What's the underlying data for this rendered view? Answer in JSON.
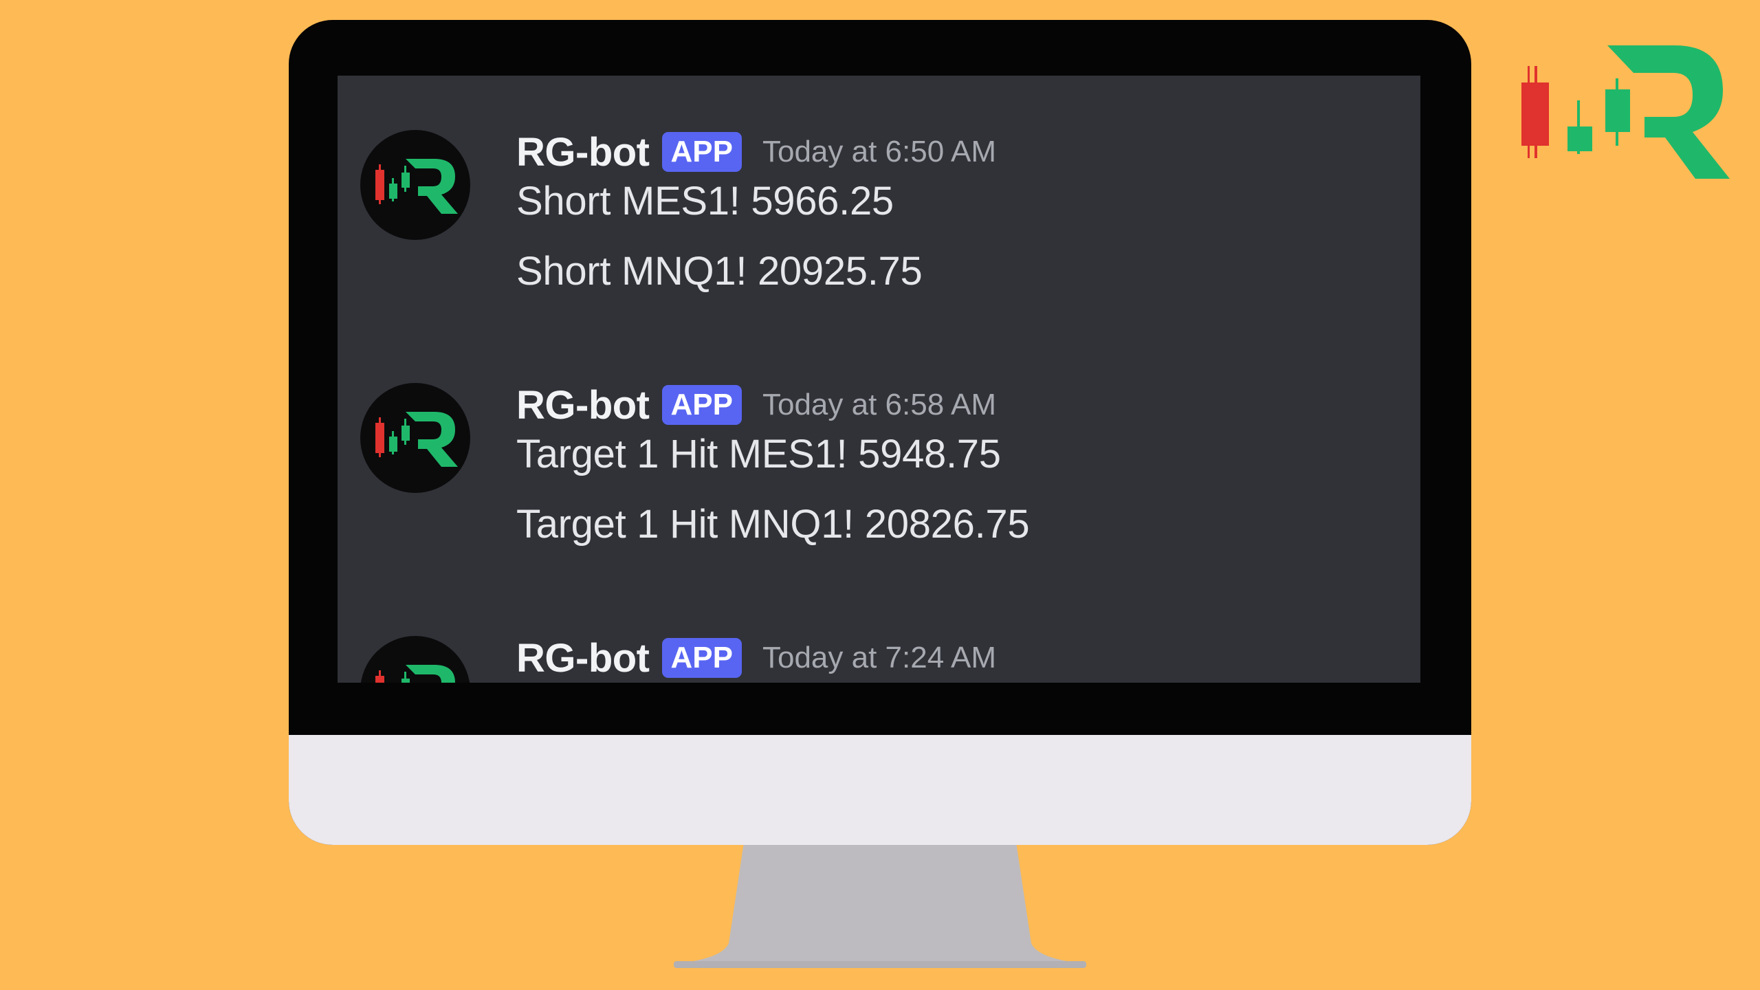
{
  "page": {
    "background_color": "#FEBA54",
    "monitor_bezel_color": "#050505",
    "monitor_chin_color": "#EBE8EE",
    "stand_color": "#BDBBBF",
    "screen_background": "#313238"
  },
  "brand": {
    "logo_icon": "candlestick-r-logo-icon",
    "red": "#E0322E",
    "green": "#1FB86A"
  },
  "chat": {
    "messages": [
      {
        "author": "RG-bot",
        "badge": "APP",
        "timestamp": "Today at 6:50 AM",
        "avatar_icon": "rg-logo-avatar-icon",
        "lines": [
          "Short MES1! 5966.25",
          "Short MNQ1! 20925.75"
        ]
      },
      {
        "author": "RG-bot",
        "badge": "APP",
        "timestamp": "Today at 6:58 AM",
        "avatar_icon": "rg-logo-avatar-icon",
        "lines": [
          "Target 1 Hit MES1! 5948.75",
          "Target 1 Hit MNQ1! 20826.75"
        ]
      },
      {
        "author": "RG-bot",
        "badge": "APP",
        "timestamp": "Today at 7:24 AM",
        "avatar_icon": "rg-logo-avatar-icon",
        "lines": []
      }
    ],
    "badge_color": "#5865F2",
    "username_color": "#F2F3F5",
    "timestamp_color": "#A7A9B0",
    "text_color": "#E6E7EA"
  }
}
